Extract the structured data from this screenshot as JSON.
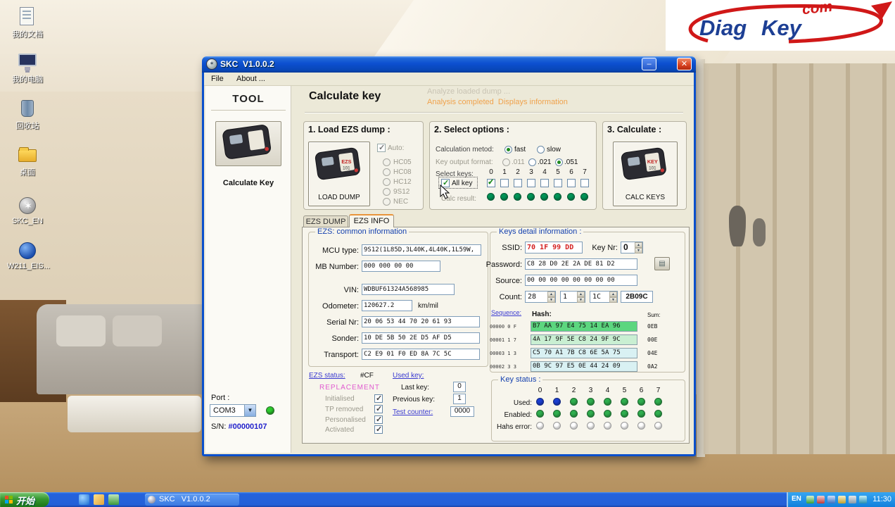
{
  "logo": {
    "diag": "Diag",
    "key": "Key",
    "com": "com"
  },
  "desktop_icons": [
    {
      "label": "我的文档"
    },
    {
      "label": "我的电脑"
    },
    {
      "label": "回收站"
    },
    {
      "label": "桌面"
    },
    {
      "label": "SKC_EN"
    },
    {
      "label": "W211_EIS..."
    }
  ],
  "window": {
    "title": "SKC  V1.0.0.2",
    "menu": {
      "file": "File",
      "about": "About ..."
    },
    "tool": {
      "title": "TOOL",
      "calc_key_label": "Calculate Key",
      "port_label": "Port :",
      "port_value": "COM3",
      "port_led_color": "#2ecb2e",
      "sn_label": "S/N:",
      "sn_value": "#00000107"
    },
    "header": {
      "title": "Calculate key",
      "status1": "Analyze loaded dump ...",
      "status2": "Analysis completed  Displays information"
    },
    "load": {
      "title": "1. Load EZS dump :",
      "button_label": "LOAD DUMP",
      "icon_text1": "EZS",
      "icon_text2": "101",
      "auto_label": "Auto:",
      "auto_checked": true,
      "mcu_options": [
        {
          "label": "HC05",
          "selected": false
        },
        {
          "label": "HC08",
          "selected": false
        },
        {
          "label": "HC12",
          "selected": false
        },
        {
          "label": "9S12",
          "selected": false
        },
        {
          "label": "NEC",
          "selected": false
        }
      ]
    },
    "options": {
      "title": "2. Select options :",
      "method_label": "Calculation metod:",
      "method_options": [
        {
          "label": "fast",
          "selected": true
        },
        {
          "label": "slow",
          "selected": false
        }
      ],
      "format_label": "Key output format:",
      "format_options": [
        {
          "label": ".011",
          "selected": false
        },
        {
          "label": ".021",
          "selected": false
        },
        {
          "label": ".051",
          "selected": true
        }
      ],
      "select_keys_label": "Select keys:",
      "all_key_label": "All key",
      "all_key_checked": true,
      "key_numbers": [
        "0",
        "1",
        "2",
        "3",
        "4",
        "5",
        "6",
        "7"
      ],
      "keys_checked": [
        true,
        true,
        true,
        true,
        true,
        true,
        true,
        true
      ],
      "calc_result_label": "Calc result:",
      "calc_result_color": "#009357"
    },
    "calculate": {
      "title": "3. Calculate :",
      "button_label": "CALC KEYS",
      "icon_text1": "KEY",
      "icon_text2": "101"
    },
    "tabs": [
      {
        "label": "EZS DUMP"
      },
      {
        "label": "EZS INFO"
      }
    ],
    "ezs_info": {
      "legend": "EZS: common information",
      "mcu_label": "MCU type:",
      "mcu_value": "9S12(1L85D,3L40K,4L40K,1L59W,",
      "mb_label": "MB Number:",
      "mb_value": "000 000 00 00",
      "vin_label": "VIN:",
      "vin_value": "WDBUF61324A568985",
      "odo_label": "Odometer:",
      "odo_value": "120627.2",
      "odo_unit": "km/mil",
      "serial_label": "Serial Nr:",
      "serial_value": "20 06 53 44 70 20 61 93",
      "sonder_label": "Sonder:",
      "sonder_value": "10 DE 5B 50 2E D5 AF D5",
      "transport_label": "Transport:",
      "transport_value": "C2 E9 01 F0 ED 8A 7C 5C"
    },
    "ezs_status": {
      "label": "EZS status:",
      "value": "#CF",
      "replacement": "REPLACEMENT",
      "replacement_color": "#e05ad0",
      "flags": [
        {
          "label": "Initialised",
          "checked": true
        },
        {
          "label": "TP removed",
          "checked": true
        },
        {
          "label": "Personalised",
          "checked": true
        },
        {
          "label": "Activated",
          "checked": true
        }
      ],
      "used_key_label": "Used key:",
      "last_key_label": "Last key:",
      "last_key_value": "0",
      "previous_key_label": "Previous key:",
      "previous_key_value": "1",
      "test_counter_label": "Test counter:",
      "test_counter_value": "0000"
    },
    "keys_detail": {
      "legend": "Keys detail information :",
      "ssid_label": "SSID:",
      "ssid_value": "70 1F 99 DD",
      "ssid_color": "#d42222",
      "key_nr_label": "Key Nr:",
      "key_nr_value": "0",
      "password_label": "Password:",
      "password_value": "C8 28 D0 2E 2A DE 81 D2",
      "source_label": "Source:",
      "source_value": "00 00 00 00 00 00 00 00",
      "count_label": "Count:",
      "count_value1": "28",
      "count_value2": "1",
      "count_value3": "1C",
      "count_value4": "2B09C",
      "sequence_label": "Sequence:",
      "hash_label": "Hash:",
      "sum_label": "Sum:",
      "rows": [
        {
          "seq": "00000 0 F",
          "hash": "B7 AA 97 E4 75 14 EA 96",
          "sum": "0EB",
          "bg": "#5cd67f"
        },
        {
          "seq": "00001 1 7",
          "hash": "4A 17 9F 5E C8 24 9F 9C",
          "sum": "00E",
          "bg": "#c9efd2"
        },
        {
          "seq": "00003 1 3",
          "hash": "C5 70 A1 7B C8 6E 5A 75",
          "sum": "04E",
          "bg": "#d9f1f3"
        },
        {
          "seq": "00002 3 3",
          "hash": "0B 9C 97 E5 0E 44 24 09",
          "sum": "0A2",
          "bg": "#d9f1f3"
        }
      ]
    },
    "key_status": {
      "legend": "Key status :",
      "columns": [
        "0",
        "1",
        "2",
        "3",
        "4",
        "5",
        "6",
        "7"
      ],
      "used_label": "Used:",
      "used_colors": [
        "#1b3fd1",
        "#1b3fd1",
        "#2fae4e",
        "#2fae4e",
        "#2fae4e",
        "#2fae4e",
        "#2fae4e",
        "#2fae4e"
      ],
      "enabled_label": "Enabled:",
      "enabled_colors": [
        "#2fae4e",
        "#2fae4e",
        "#2fae4e",
        "#2fae4e",
        "#2fae4e",
        "#2fae4e",
        "#2fae4e",
        "#2fae4e"
      ],
      "hash_error_label": "Hahs error:",
      "hash_error_colors": [
        "#ffffff",
        "#ffffff",
        "#ffffff",
        "#ffffff",
        "#ffffff",
        "#ffffff",
        "#ffffff",
        "#ffffff"
      ]
    }
  },
  "taskbar": {
    "start": "开始",
    "task_button": "SKC   V1.0.0.2",
    "lang": "EN",
    "time": "11:30"
  }
}
